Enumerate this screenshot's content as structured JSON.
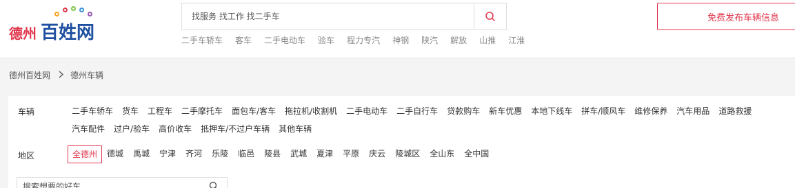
{
  "header": {
    "logo": {
      "city": "德州",
      "brand": "百姓网"
    },
    "search": {
      "placeholder": "找服务 找工作 找二手车"
    },
    "hot_links": [
      "二手车轿车",
      "客车",
      "二手电动车",
      "验车",
      "程力专汽",
      "神钢",
      "陕汽",
      "解放",
      "山推",
      "江淮"
    ],
    "publish_label": "免费发布车辆信息"
  },
  "breadcrumb": {
    "items": [
      "德州百姓网",
      "德州车辆"
    ]
  },
  "filters": {
    "vehicle": {
      "label": "车辆",
      "items": [
        "二手车轿车",
        "货车",
        "工程车",
        "二手摩托车",
        "面包车/客车",
        "拖拉机/收割机",
        "二手电动车",
        "二手自行车",
        "贷款购车",
        "新车优惠",
        "本地下线车",
        "拼车/顺风车",
        "维修保养",
        "汽车用品",
        "道路救援",
        "汽车配件",
        "过户/验车",
        "高价收车",
        "抵押车/不过户车辆",
        "其他车辆"
      ]
    },
    "region": {
      "label": "地区",
      "items": [
        "全德州",
        "德城",
        "禹城",
        "宁津",
        "齐河",
        "乐陵",
        "临邑",
        "陵县",
        "武城",
        "夏津",
        "平原",
        "庆云",
        "陵城区",
        "全山东",
        "全中国"
      ],
      "active_index": 0
    }
  },
  "car_search": {
    "placeholder": "搜索想要的好车"
  },
  "colors": {
    "accent": "#e1364c",
    "brand_blue": "#1e4fa0"
  },
  "icons": {
    "search": "search-icon",
    "breadcrumb_sep": "chevron-right-icon"
  }
}
